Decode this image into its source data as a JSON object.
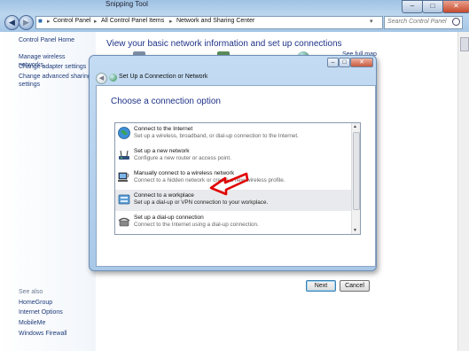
{
  "window": {
    "title": "Snipping Tool"
  },
  "address_bar": {
    "segments": [
      "Control Panel",
      "All Control Panel Items",
      "Network and Sharing Center"
    ]
  },
  "search": {
    "placeholder": "Search Control Panel"
  },
  "left_pane": {
    "home": "Control Panel Home",
    "tasks": [
      "Manage wireless networks",
      "Change adapter settings",
      "Change advanced sharing settings"
    ],
    "see_also_title": "See also",
    "see_also": [
      "HomeGroup",
      "Internet Options",
      "MobileMe",
      "Windows Firewall"
    ]
  },
  "main": {
    "heading": "View your basic network information and set up connections",
    "see_full_map": "See full map"
  },
  "dialog": {
    "title": "Set Up a Connection or Network",
    "heading": "Choose a connection option",
    "options": [
      {
        "title": "Connect to the Internet",
        "desc": "Set up a wireless, broadband, or dial-up connection to the Internet.",
        "icon": "globe-icon"
      },
      {
        "title": "Set up a new network",
        "desc": "Configure a new router or access point.",
        "icon": "router-icon"
      },
      {
        "title": "Manually connect to a wireless network",
        "desc": "Connect to a hidden network or create a new wireless profile.",
        "icon": "wireless-icon"
      },
      {
        "title": "Connect to a workplace",
        "desc": "Set up a dial-up or VPN connection to your workplace.",
        "icon": "workplace-icon",
        "selected": true
      },
      {
        "title": "Set up a dial-up connection",
        "desc": "Connect to the Internet using a dial-up connection.",
        "icon": "phone-icon"
      }
    ],
    "buttons": {
      "next": "Next",
      "cancel": "Cancel"
    }
  },
  "colors": {
    "heading": "#1e3287",
    "link": "#1f3b7a",
    "annotation_arrow": "#e00000"
  }
}
